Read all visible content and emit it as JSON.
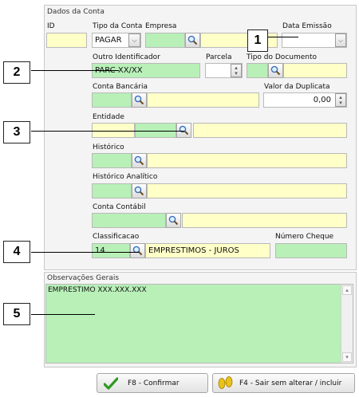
{
  "section_title": "Dados da Conta",
  "fields": {
    "id": {
      "label": "ID",
      "value": ""
    },
    "tipo_conta": {
      "label": "Tipo da Conta",
      "value": "PAGAR"
    },
    "empresa": {
      "label": "Empresa",
      "code": "",
      "name": ""
    },
    "data_emissao": {
      "label": "Data Emissão",
      "value": ""
    },
    "outro_identificador": {
      "label": "Outro Identificador",
      "value": "PARC XX/XX"
    },
    "parcela": {
      "label": "Parcela",
      "value": ""
    },
    "tipo_documento": {
      "label": "Tipo do Documento",
      "code": "",
      "name": ""
    },
    "conta_bancaria": {
      "label": "Conta Bancária",
      "code": "",
      "name": ""
    },
    "valor_duplicata": {
      "label": "Valor da Duplicata",
      "value": "0,00"
    },
    "entidade": {
      "label": "Entidade",
      "code": "",
      "code2": "",
      "name": ""
    },
    "historico": {
      "label": "Histórico",
      "code": "",
      "name": ""
    },
    "historico_analitico": {
      "label": "Histórico Analítico",
      "code": "",
      "name": ""
    },
    "conta_contabil": {
      "label": "Conta Contábil",
      "code": "",
      "name": ""
    },
    "classificacao": {
      "label": "Classificacao",
      "code": "14",
      "name": "EMPRESTIMOS - JUROS"
    },
    "numero_cheque": {
      "label": "Número Cheque",
      "value": ""
    }
  },
  "observacoes": {
    "label": "Observações Gerais",
    "text": "EMPRESTIMO XXX.XXX.XXX"
  },
  "buttons": {
    "confirm": "F8 - Confirmar",
    "cancel": "F4 - Sair sem alterar / incluir"
  },
  "annotations": [
    "1",
    "2",
    "3",
    "4",
    "5"
  ],
  "icons": {
    "search": "search-icon",
    "dropdown": "chevron-down-icon",
    "spinner": "spin-arrows-icon",
    "confirm": "checkmark-icon",
    "cancel": "footprints-icon"
  }
}
